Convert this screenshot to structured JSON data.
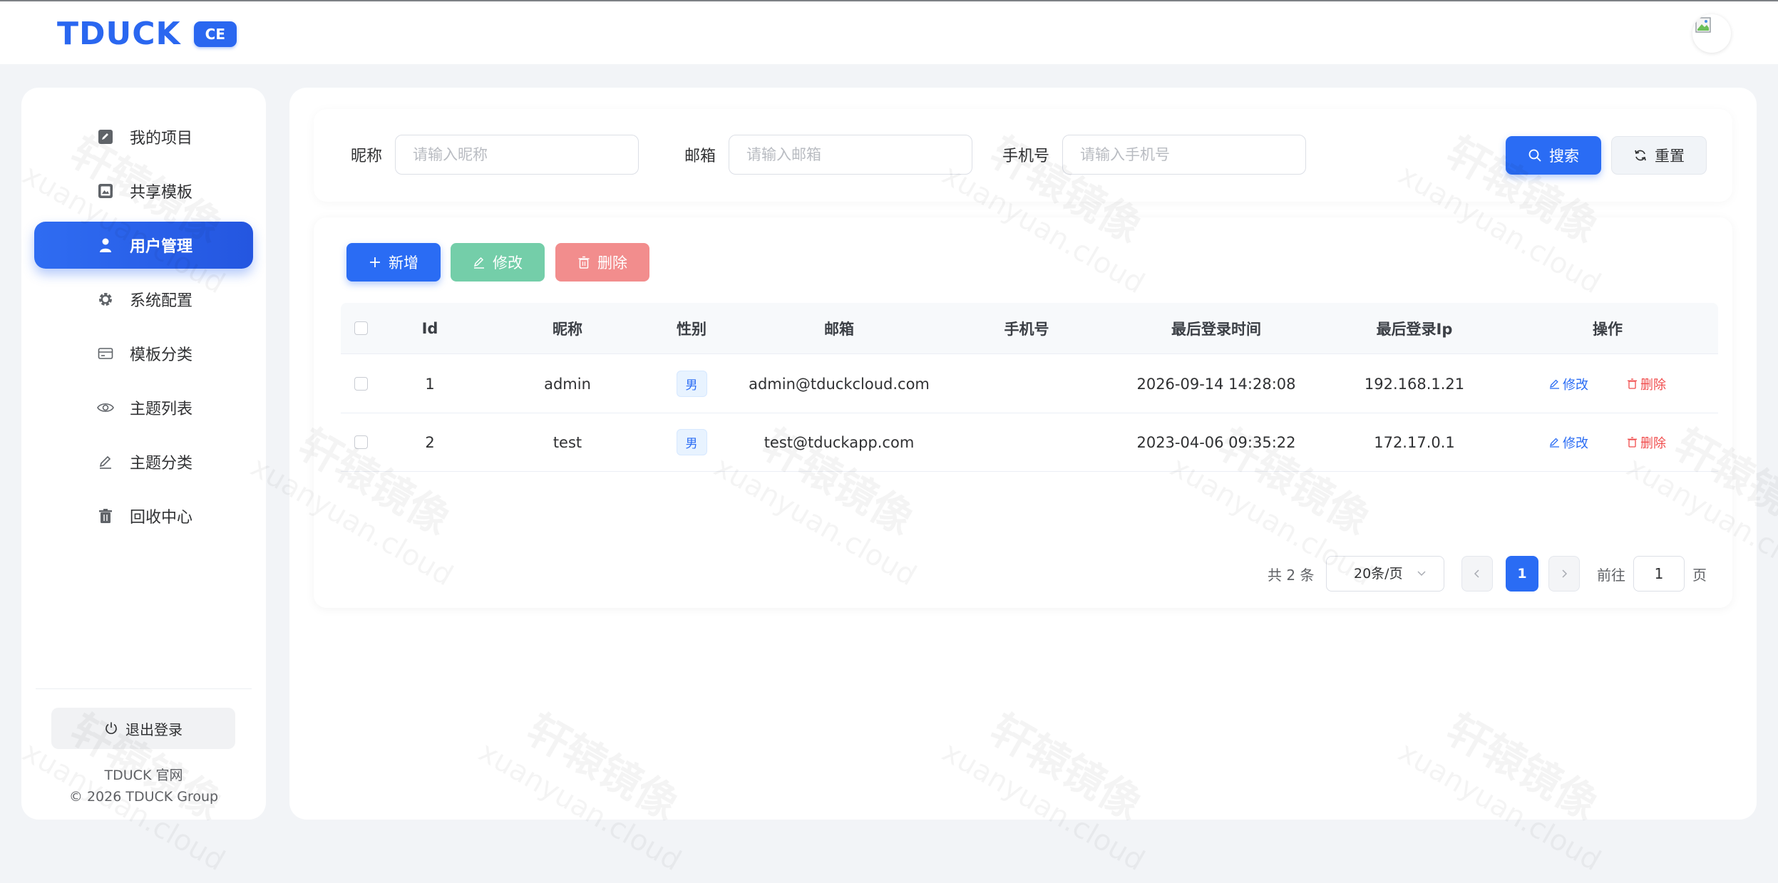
{
  "header": {
    "logo_text": "TDUCK",
    "logo_badge": "CE"
  },
  "sidebar": {
    "items": [
      {
        "label": "我的项目",
        "icon": "edit-square-icon",
        "active": false
      },
      {
        "label": "共享模板",
        "icon": "image-icon",
        "active": false
      },
      {
        "label": "用户管理",
        "icon": "user-icon",
        "active": true
      },
      {
        "label": "系统配置",
        "icon": "gear-icon",
        "active": false
      },
      {
        "label": "模板分类",
        "icon": "card-icon",
        "active": false
      },
      {
        "label": "主题列表",
        "icon": "eye-icon",
        "active": false
      },
      {
        "label": "主题分类",
        "icon": "pencil-icon",
        "active": false
      },
      {
        "label": "回收中心",
        "icon": "trash-icon",
        "active": false
      }
    ],
    "logout_label": "退出登录",
    "footer_line1": "TDUCK 官网",
    "footer_line2": "© 2026 TDUCK Group"
  },
  "search": {
    "nickname_label": "昵称",
    "nickname_placeholder": "请输入昵称",
    "nickname_value": "",
    "email_label": "邮箱",
    "email_placeholder": "请输入邮箱",
    "email_value": "",
    "phone_label": "手机号",
    "phone_placeholder": "请输入手机号",
    "phone_value": "",
    "search_label": "搜索",
    "reset_label": "重置"
  },
  "toolbar": {
    "add_label": "新增",
    "edit_label": "修改",
    "delete_label": "删除"
  },
  "table": {
    "columns": [
      "Id",
      "昵称",
      "性别",
      "邮箱",
      "手机号",
      "最后登录时间",
      "最后登录Ip",
      "操作"
    ],
    "rows": [
      {
        "id": "1",
        "nickname": "admin",
        "gender": "男",
        "email": "admin@tduckcloud.com",
        "phone": "",
        "last_login_time": "2026-09-14 14:28:08",
        "last_login_ip": "192.168.1.21",
        "edit": "修改",
        "delete": "删除"
      },
      {
        "id": "2",
        "nickname": "test",
        "gender": "男",
        "email": "test@tduckapp.com",
        "phone": "",
        "last_login_time": "2023-04-06 09:35:22",
        "last_login_ip": "172.17.0.1",
        "edit": "修改",
        "delete": "删除"
      }
    ]
  },
  "pagination": {
    "total_text": "共 2 条",
    "page_size": "20条/页",
    "current_page": "1",
    "goto_label": "前往",
    "goto_value": "1",
    "page_suffix": "页"
  },
  "watermark": {
    "text": "轩辕镜像",
    "subtext": "xuanyuan.cloud"
  },
  "colors": {
    "primary": "#2a6cf4",
    "success": "#74cea9",
    "danger": "#f28d8d"
  }
}
